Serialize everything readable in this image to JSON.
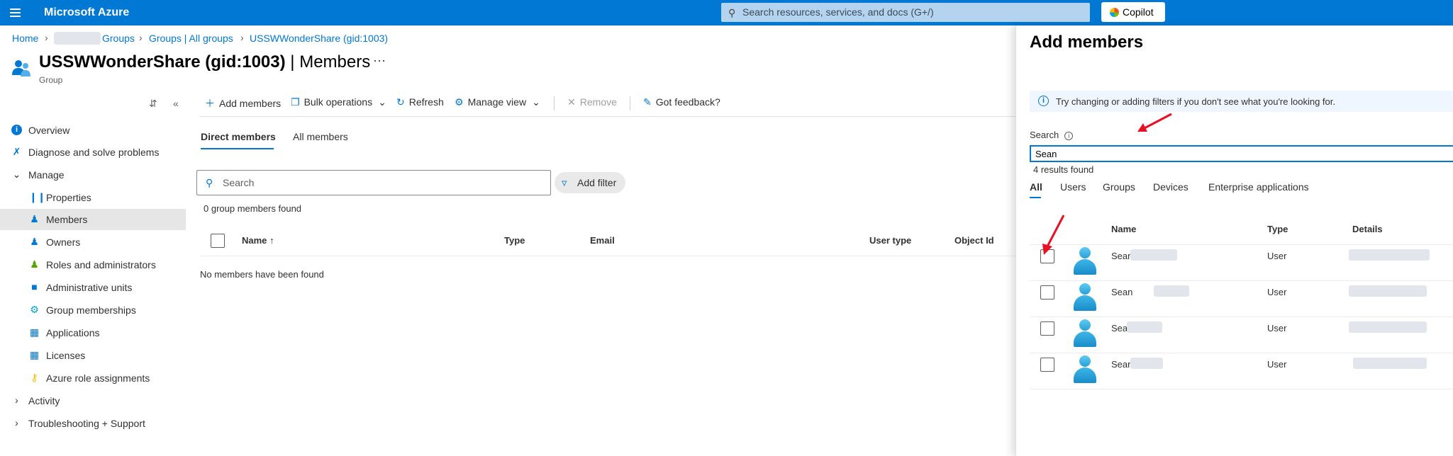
{
  "topbar": {
    "brand": "Microsoft Azure",
    "search_placeholder": "Search resources, services, and docs (G+/)",
    "copilot_label": "Copilot"
  },
  "breadcrumb": {
    "home": "Home",
    "groups": "Groups",
    "all_groups": "Groups | All groups",
    "current": "USSWWonderShare (gid:1003)"
  },
  "header": {
    "title": "USSWWonderShare (gid:1003)",
    "separator": " | ",
    "section": "Members",
    "more": "···",
    "subtitle": "Group"
  },
  "sidebar": {
    "items": [
      {
        "label": "Overview"
      },
      {
        "label": "Diagnose and solve problems"
      },
      {
        "label": "Manage"
      },
      {
        "label": "Properties"
      },
      {
        "label": "Members"
      },
      {
        "label": "Owners"
      },
      {
        "label": "Roles and administrators"
      },
      {
        "label": "Administrative units"
      },
      {
        "label": "Group memberships"
      },
      {
        "label": "Applications"
      },
      {
        "label": "Licenses"
      },
      {
        "label": "Azure role assignments"
      },
      {
        "label": "Activity"
      },
      {
        "label": "Troubleshooting + Support"
      }
    ]
  },
  "toolbar": {
    "add_members": "Add members",
    "bulk_operations": "Bulk operations",
    "refresh": "Refresh",
    "manage_view": "Manage view",
    "remove": "Remove",
    "got_feedback": "Got feedback?"
  },
  "tabs": {
    "direct": "Direct members",
    "all": "All members"
  },
  "members": {
    "search_placeholder": "Search",
    "add_filter": "Add filter",
    "count": "0 group members found",
    "columns": {
      "name": "Name ↑",
      "type": "Type",
      "email": "Email",
      "user_type": "User type",
      "object_id": "Object Id"
    },
    "empty": "No members have been found"
  },
  "panel": {
    "title": "Add members",
    "info": "Try changing or adding filters if you don't see what you're looking for.",
    "search_label": "Search",
    "search_value": "Sean",
    "results": "4 results found",
    "tabs": [
      "All",
      "Users",
      "Groups",
      "Devices",
      "Enterprise applications"
    ],
    "columns": {
      "name": "Name",
      "type": "Type",
      "details": "Details"
    },
    "rows": [
      {
        "name": "Sean",
        "type": "User"
      },
      {
        "name": "Sean",
        "type": "User"
      },
      {
        "name": "Sea",
        "type": "User"
      },
      {
        "name": "Sean",
        "type": "User"
      }
    ]
  },
  "colors": {
    "accent": "#0078d4",
    "annotation_arrow": "#e81123"
  }
}
